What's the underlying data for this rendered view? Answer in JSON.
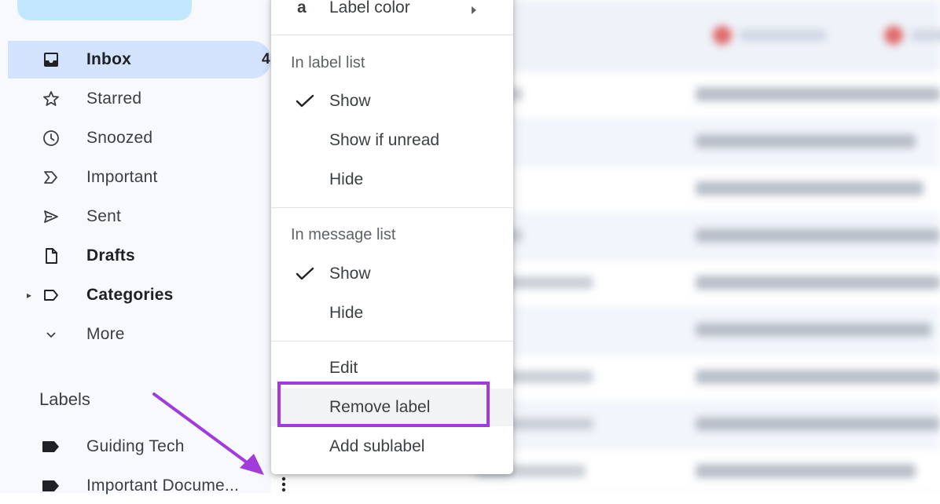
{
  "sidebar": {
    "items": [
      {
        "label": "Inbox",
        "count": "4"
      },
      {
        "label": "Starred"
      },
      {
        "label": "Snoozed"
      },
      {
        "label": "Important"
      },
      {
        "label": "Sent"
      },
      {
        "label": "Drafts"
      },
      {
        "label": "Categories"
      },
      {
        "label": "More"
      }
    ],
    "labels_heading": "Labels",
    "labels": [
      {
        "label": "Guiding Tech",
        "icon": "label-icon"
      },
      {
        "label": "Important Docume...",
        "icon": "label-icon"
      }
    ]
  },
  "menu": {
    "label_color": {
      "glyph": "a",
      "label": "Label color"
    },
    "in_label_list": {
      "heading": "In label list",
      "options": [
        "Show",
        "Show if unread",
        "Hide"
      ],
      "selected": "Show"
    },
    "in_message_list": {
      "heading": "In message list",
      "options": [
        "Show",
        "Hide"
      ],
      "selected": "Show"
    },
    "actions": [
      "Edit",
      "Remove label",
      "Add sublabel"
    ]
  },
  "colors": {
    "accent_highlight": "#a23bdc",
    "active_nav": "#d3e3fd",
    "compose": "#c2e7ff"
  }
}
